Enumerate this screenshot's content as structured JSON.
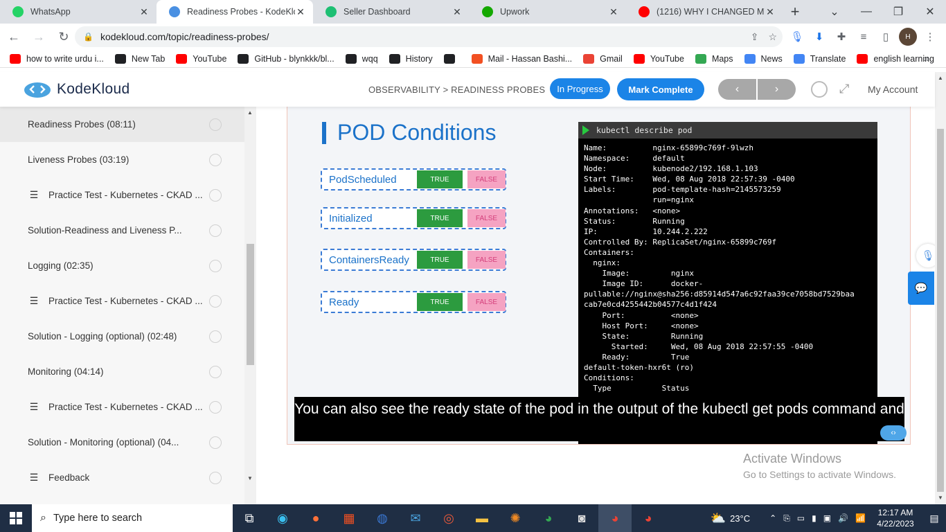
{
  "browser": {
    "tabs": [
      {
        "title": "WhatsApp",
        "icon": "whatsapp-icon",
        "color": "#25d366",
        "active": false
      },
      {
        "title": "Readiness Probes - KodeKlou",
        "icon": "kodekloud-icon",
        "color": "#4a90e2",
        "active": true
      },
      {
        "title": "Seller Dashboard",
        "icon": "fiverr-icon",
        "color": "#1dbf73",
        "active": false
      },
      {
        "title": "Upwork",
        "icon": "upwork-icon",
        "color": "#14a800",
        "active": false
      },
      {
        "title": "(1216) WHY I CHANGED MY",
        "icon": "youtube-icon",
        "color": "#ff0000",
        "active": false
      }
    ],
    "url": "kodekloud.com/topic/readiness-probes/",
    "bookmarks": [
      {
        "label": "how to write urdu i...",
        "icon": "youtube-icon",
        "color": "#ff0000"
      },
      {
        "label": "New Tab",
        "icon": "globe-icon",
        "color": "#202124"
      },
      {
        "label": "YouTube",
        "icon": "youtube-icon",
        "color": "#ff0000"
      },
      {
        "label": "GitHub - blynkkk/bl...",
        "icon": "github-icon",
        "color": "#202124"
      },
      {
        "label": "wqq",
        "icon": "download-icon",
        "color": "#202124"
      },
      {
        "label": "History",
        "icon": "history-icon",
        "color": "#202124"
      },
      {
        "label": "",
        "icon": "globe-icon",
        "color": "#202124"
      },
      {
        "label": "Mail - Hassan Bashi...",
        "icon": "microsoft-icon",
        "color": "#f25022"
      },
      {
        "label": "Gmail",
        "icon": "gmail-icon",
        "color": "#ea4335"
      },
      {
        "label": "YouTube",
        "icon": "youtube-icon",
        "color": "#ff0000"
      },
      {
        "label": "Maps",
        "icon": "maps-icon",
        "color": "#34a853"
      },
      {
        "label": "News",
        "icon": "news-icon",
        "color": "#4285f4"
      },
      {
        "label": "Translate",
        "icon": "translate-icon",
        "color": "#4285f4"
      },
      {
        "label": "english learning",
        "icon": "youtube-icon",
        "color": "#ff0000"
      }
    ]
  },
  "header": {
    "brand": "KodeKloud",
    "breadcrumb": "OBSERVABILITY > READINESS PROBES",
    "in_progress": "In Progress",
    "mark_complete": "Mark Complete",
    "prev": "‹",
    "next": "›",
    "account": "My Account"
  },
  "sidebar": {
    "lessons": [
      {
        "title": "Readiness Probes (08:11)",
        "type": "video",
        "active": true
      },
      {
        "title": "Liveness Probes (03:19)",
        "type": "video",
        "active": false
      },
      {
        "title": "Practice Test - Kubernetes - CKAD ...",
        "type": "list",
        "active": false
      },
      {
        "title": "Solution-Readiness and Liveness P...",
        "type": "video",
        "active": false
      },
      {
        "title": "Logging (02:35)",
        "type": "video",
        "active": false
      },
      {
        "title": "Practice Test - Kubernetes - CKAD ...",
        "type": "list",
        "active": false
      },
      {
        "title": "Solution - Logging (optional) (02:48)",
        "type": "video",
        "active": false
      },
      {
        "title": "Monitoring (04:14)",
        "type": "video",
        "active": false
      },
      {
        "title": "Practice Test - Kubernetes - CKAD ...",
        "type": "list",
        "active": false
      },
      {
        "title": "Solution - Monitoring (optional) (04...",
        "type": "video",
        "active": false
      },
      {
        "title": "Feedback",
        "type": "list",
        "active": false
      }
    ]
  },
  "video": {
    "slide_title": "POD Conditions",
    "conditions": [
      {
        "name": "PodScheduled",
        "true": "TRUE",
        "false": "FALSE"
      },
      {
        "name": "Initialized",
        "true": "TRUE",
        "false": "FALSE"
      },
      {
        "name": "ContainersReady",
        "true": "TRUE",
        "false": "FALSE"
      },
      {
        "name": "Ready",
        "true": "TRUE",
        "false": "FALSE"
      }
    ],
    "terminal_command": "kubectl describe pod",
    "terminal_output": "Name:          nginx-65899c769f-9lwzh\nNamespace:     default\nNode:          kubenode2/192.168.1.103\nStart Time:    Wed, 08 Aug 2018 22:57:39 -0400\nLabels:        pod-template-hash=2145573259\n               run=nginx\nAnnotations:   <none>\nStatus:        Running\nIP:            10.244.2.222\nControlled By: ReplicaSet/nginx-65899c769f\nContainers:\n  nginx:\n    Image:         nginx\n    Image ID:      docker-\npullable://nginx@sha256:d85914d547a6c92faa39ce7058bd7529baa\ncab7e0cd4255442b04577c4d1f424\n    Port:          <none>\n    Host Port:     <none>\n    State:         Running\n      Started:     Wed, 08 Aug 2018 22:57:55 -0400\n    Ready:         True\ndefault-token-hxr6t (ro)\nConditions:\n  Type           Status",
    "caption": "You can also see the ready state of the pod in the output of the kubectl get pods command and"
  },
  "activate": {
    "line1": "Activate Windows",
    "line2": "Go to Settings to activate Windows."
  },
  "taskbar": {
    "search_placeholder": "Type here to search",
    "temperature": "23°C",
    "time": "12:17 AM",
    "date": "4/22/2023"
  }
}
